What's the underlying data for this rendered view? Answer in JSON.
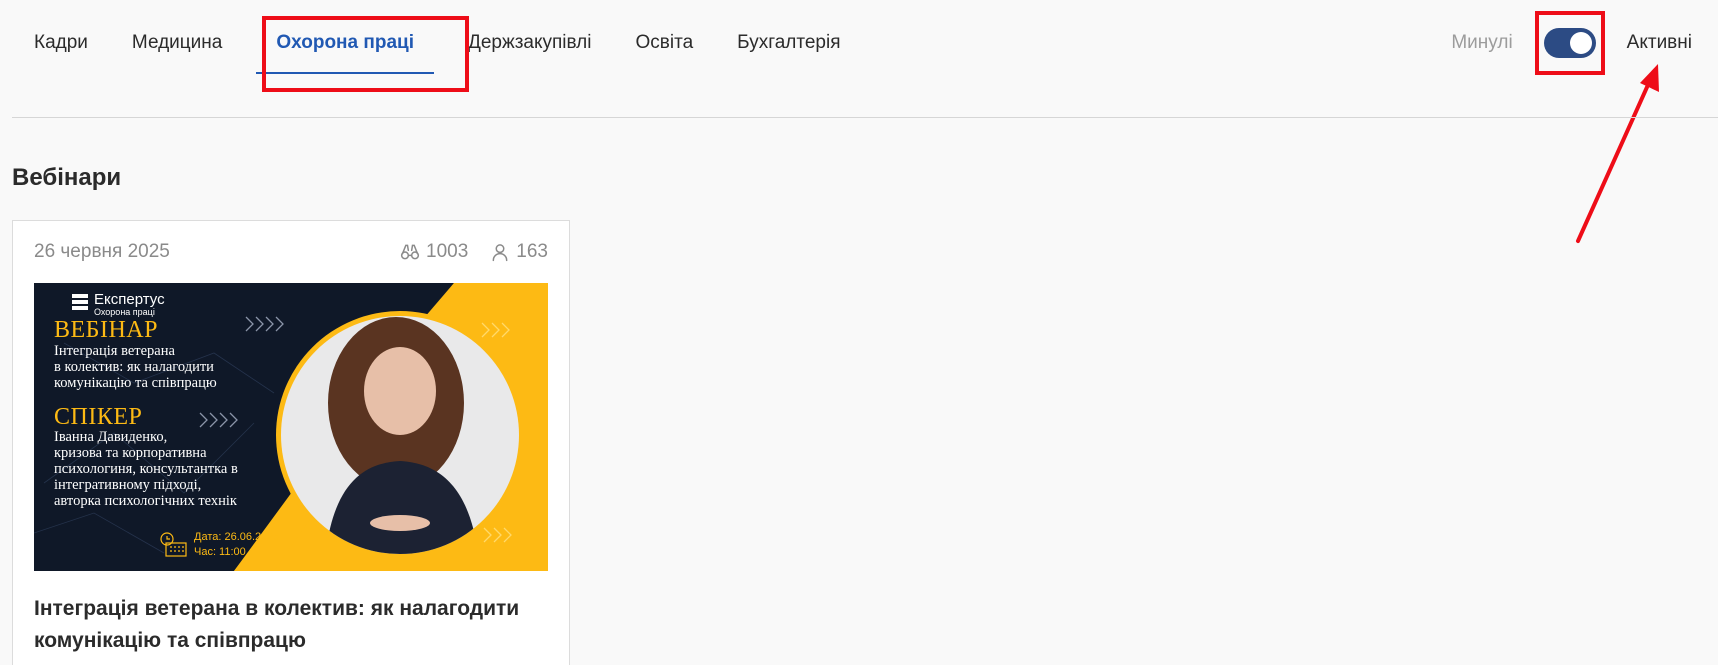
{
  "nav": {
    "tabs": [
      {
        "label": "Кадри",
        "active": false
      },
      {
        "label": "Медицина",
        "active": false
      },
      {
        "label": "Охорона праці",
        "active": true
      },
      {
        "label": "Держзакупівлі",
        "active": false
      },
      {
        "label": "Освіта",
        "active": false
      },
      {
        "label": "Бухгалтерія",
        "active": false
      }
    ]
  },
  "filter": {
    "past_label": "Минулі",
    "active_label": "Активні",
    "toggle_state": "active"
  },
  "section": {
    "title": "Вебінари"
  },
  "card": {
    "date": "26 червня 2025",
    "views": "1003",
    "participants": "163",
    "title": "Інтеграція ветерана в колектив: як налагодити комунікацію та співпрацю",
    "banner": {
      "brand": "Експертус",
      "brand_sub": "Охорона праці",
      "webinar_heading": "ВЕБІНАР",
      "webinar_lines": [
        "Інтеграція ветерана",
        "в колектив: як налагодити",
        "комунікацію та співпрацю"
      ],
      "speaker_heading": "СПІКЕР",
      "speaker_lines": [
        "Іванна Давиденко,",
        "кризова та корпоративна",
        "психологиня, консультантка в",
        "інтегративному підході,",
        "авторка психологічних технік"
      ],
      "date_line": "Дата: 26.06.2025",
      "time_line": "Час: 11:00"
    }
  },
  "colors": {
    "accent": "#2159b3",
    "highlight": "#ee0d18",
    "toggle": "#2c4b84",
    "banner_yellow": "#fdba14",
    "banner_dark": "#0f1828"
  }
}
